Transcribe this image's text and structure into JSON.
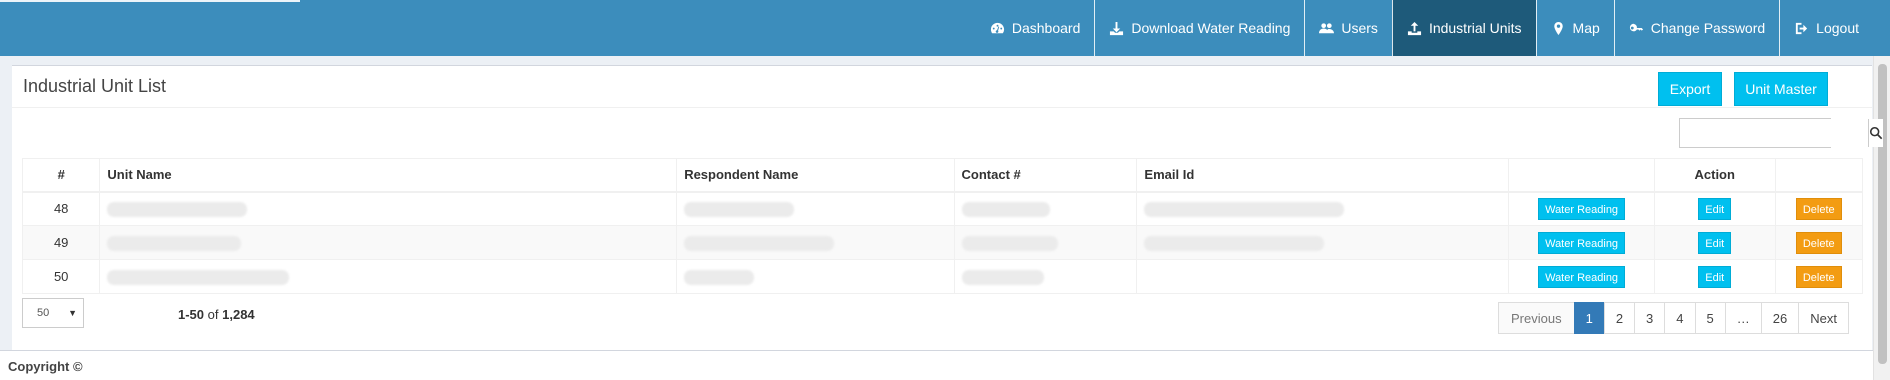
{
  "nav": {
    "items": [
      {
        "label": "Dashboard",
        "icon": "dashboard-icon"
      },
      {
        "label": "Download Water Reading",
        "icon": "download-icon"
      },
      {
        "label": "Users",
        "icon": "users-icon"
      },
      {
        "label": "Industrial Units",
        "icon": "upload-icon",
        "active": true
      },
      {
        "label": "Map",
        "icon": "map-marker-icon"
      },
      {
        "label": "Change Password",
        "icon": "key-icon"
      },
      {
        "label": "Logout",
        "icon": "sign-out-icon"
      }
    ]
  },
  "panel": {
    "title": "Industrial Unit List",
    "export_label": "Export",
    "unit_master_label": "Unit Master",
    "search_placeholder": ""
  },
  "table": {
    "headers": {
      "index": "#",
      "unit_name": "Unit Name",
      "respondent_name": "Respondent Name",
      "contact": "Contact #",
      "email": "Email Id",
      "action": "Action"
    },
    "rows": [
      {
        "index": "48",
        "water_reading": "Water Reading",
        "edit": "Edit",
        "delete": "Delete"
      },
      {
        "index": "49",
        "water_reading": "Water Reading",
        "edit": "Edit",
        "delete": "Delete"
      },
      {
        "index": "50",
        "water_reading": "Water Reading",
        "edit": "Edit",
        "delete": "Delete"
      }
    ]
  },
  "pagination": {
    "page_size": "50",
    "range": "1-50",
    "of_label": "of",
    "total": "1,284",
    "previous": "Previous",
    "pages": [
      "1",
      "2",
      "3",
      "4",
      "5",
      "…",
      "26"
    ],
    "active_page": "1",
    "next": "Next"
  },
  "footer": {
    "copyright": "Copyright ©"
  },
  "colors": {
    "navbar": "#3c8dbc",
    "nav_active": "#1e5a7a",
    "info": "#00c0ef",
    "warning": "#f39c12",
    "page_active": "#337ab7"
  }
}
